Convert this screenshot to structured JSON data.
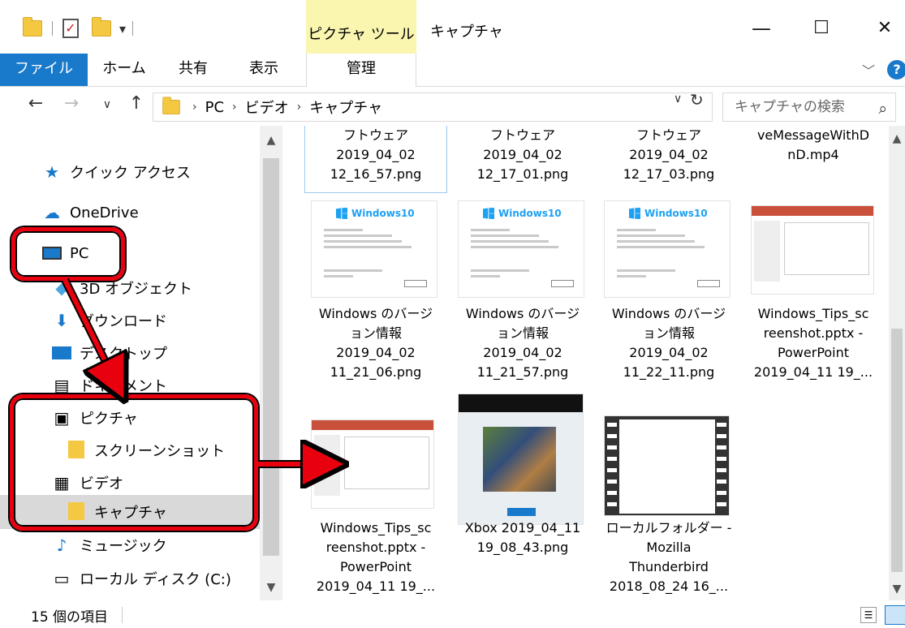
{
  "titlebar": {
    "context_tool_label": "ピクチャ ツール",
    "window_title": "キャプチャ",
    "min_glyph": "—",
    "max_glyph": "☐",
    "close_glyph": "✕"
  },
  "ribbon": {
    "tabs": [
      {
        "label": "ファイル"
      },
      {
        "label": "ホーム"
      },
      {
        "label": "共有"
      },
      {
        "label": "表示"
      },
      {
        "label": "管理"
      }
    ],
    "help_label": "?"
  },
  "address": {
    "crumbs": [
      "PC",
      "ビデオ",
      "キャプチャ"
    ],
    "search_placeholder": "キャプチャの検索"
  },
  "navpane": {
    "items": [
      {
        "label": "クイック アクセス",
        "icon": "star-icon"
      },
      {
        "label": "OneDrive",
        "icon": "cloud-icon"
      },
      {
        "label": "PC",
        "icon": "monitor-icon"
      },
      {
        "label": "3D オブジェクト",
        "icon": "cube-icon"
      },
      {
        "label": "ダウンロード",
        "icon": "download-icon"
      },
      {
        "label": "デスクトップ",
        "icon": "desktop-icon"
      },
      {
        "label": "ドキュメント",
        "icon": "document-icon"
      },
      {
        "label": "ピクチャ",
        "icon": "picture-icon"
      },
      {
        "label": "スクリーンショット",
        "icon": "folder-icon"
      },
      {
        "label": "ビデオ",
        "icon": "video-icon"
      },
      {
        "label": "キャプチャ",
        "icon": "folder-icon"
      },
      {
        "label": "ミュージック",
        "icon": "music-icon"
      },
      {
        "label": "ローカル ディスク (C:)",
        "icon": "drive-icon"
      }
    ]
  },
  "files": {
    "row0": [
      {
        "lines": [
          "フトウェア",
          "2019_04_02",
          "12_16_57.png"
        ]
      },
      {
        "lines": [
          "フトウェア",
          "2019_04_02",
          "12_17_01.png"
        ]
      },
      {
        "lines": [
          "フトウェア",
          "2019_04_02",
          "12_17_03.png"
        ]
      },
      {
        "lines": [
          "veMessageWithD",
          "nD.mp4"
        ]
      }
    ],
    "row1": [
      {
        "lines": [
          "Windows のバージ",
          "ョン情報",
          "2019_04_02",
          "11_21_06.png"
        ]
      },
      {
        "lines": [
          "Windows のバージ",
          "ョン情報",
          "2019_04_02",
          "11_21_57.png"
        ]
      },
      {
        "lines": [
          "Windows のバージ",
          "ョン情報",
          "2019_04_02",
          "11_22_11.png"
        ]
      },
      {
        "lines": [
          "Windows_Tips_sc",
          "reenshot.pptx -",
          "PowerPoint",
          "2019_04_11 19_..."
        ]
      }
    ],
    "row2": [
      {
        "lines": [
          "Windows_Tips_sc",
          "reenshot.pptx -",
          "PowerPoint",
          "2019_04_11 19_..."
        ]
      },
      {
        "lines": [
          "Xbox 2019_04_11",
          "19_08_43.png"
        ]
      },
      {
        "lines": [
          "ローカルフォルダー -",
          "Mozilla",
          "Thunderbird",
          "2018_08_24 16_..."
        ]
      }
    ],
    "win_thumb_label": "Windows10"
  },
  "status": {
    "count_text": "15 個の項目"
  }
}
